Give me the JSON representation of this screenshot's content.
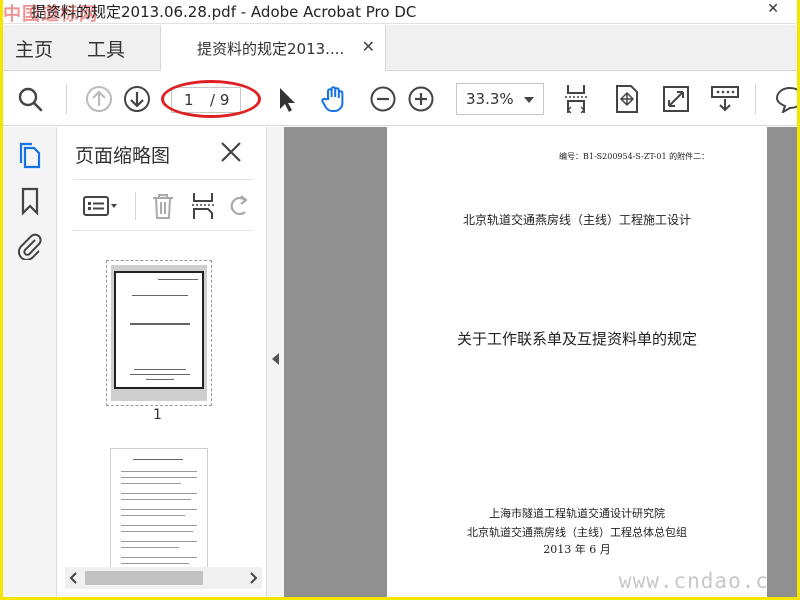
{
  "window": {
    "title": "提资料的规定2013.06.28.pdf - Adobe Acrobat Pro DC",
    "watermark_top": "中国道标网",
    "close_glyph": "✕"
  },
  "tabs": {
    "home": "主页",
    "tools": "工具",
    "document": "提资料的规定2013....",
    "document_close": "✕"
  },
  "toolbar": {
    "page_current": "1",
    "page_total": "/ 9",
    "zoom": "33.3%",
    "icons": [
      "search-icon",
      "prev-page-icon",
      "next-page-icon",
      "select-cursor-icon",
      "hand-tool-icon",
      "zoom-out-icon",
      "zoom-in-icon",
      "scroll-mode-icon",
      "fit-page-icon",
      "full-screen-icon",
      "read-mode-icon",
      "comment-icon"
    ],
    "accent": "#1473e6",
    "annotation_color": "#e02020"
  },
  "rail": {
    "icons": [
      "pages-icon",
      "bookmark-icon",
      "attachment-icon"
    ]
  },
  "panel": {
    "title": "页面缩略图",
    "thumbnails": [
      {
        "label": "1"
      },
      {
        "label": ""
      }
    ]
  },
  "document": {
    "code": "编号：B1-S200954-S-ZT-01 的附件二：",
    "project": "北京轨道交通燕房线（主线）工程施工设计",
    "title": "关于工作联系单及互提资料单的规定",
    "org1": "上海市隧道工程轨道交通设计研究院",
    "org2": "北京轨道交通燕房线（主线）工程总体总包组",
    "date": "2013 年 6 月"
  },
  "watermark_bottom": "www.cndao.c"
}
